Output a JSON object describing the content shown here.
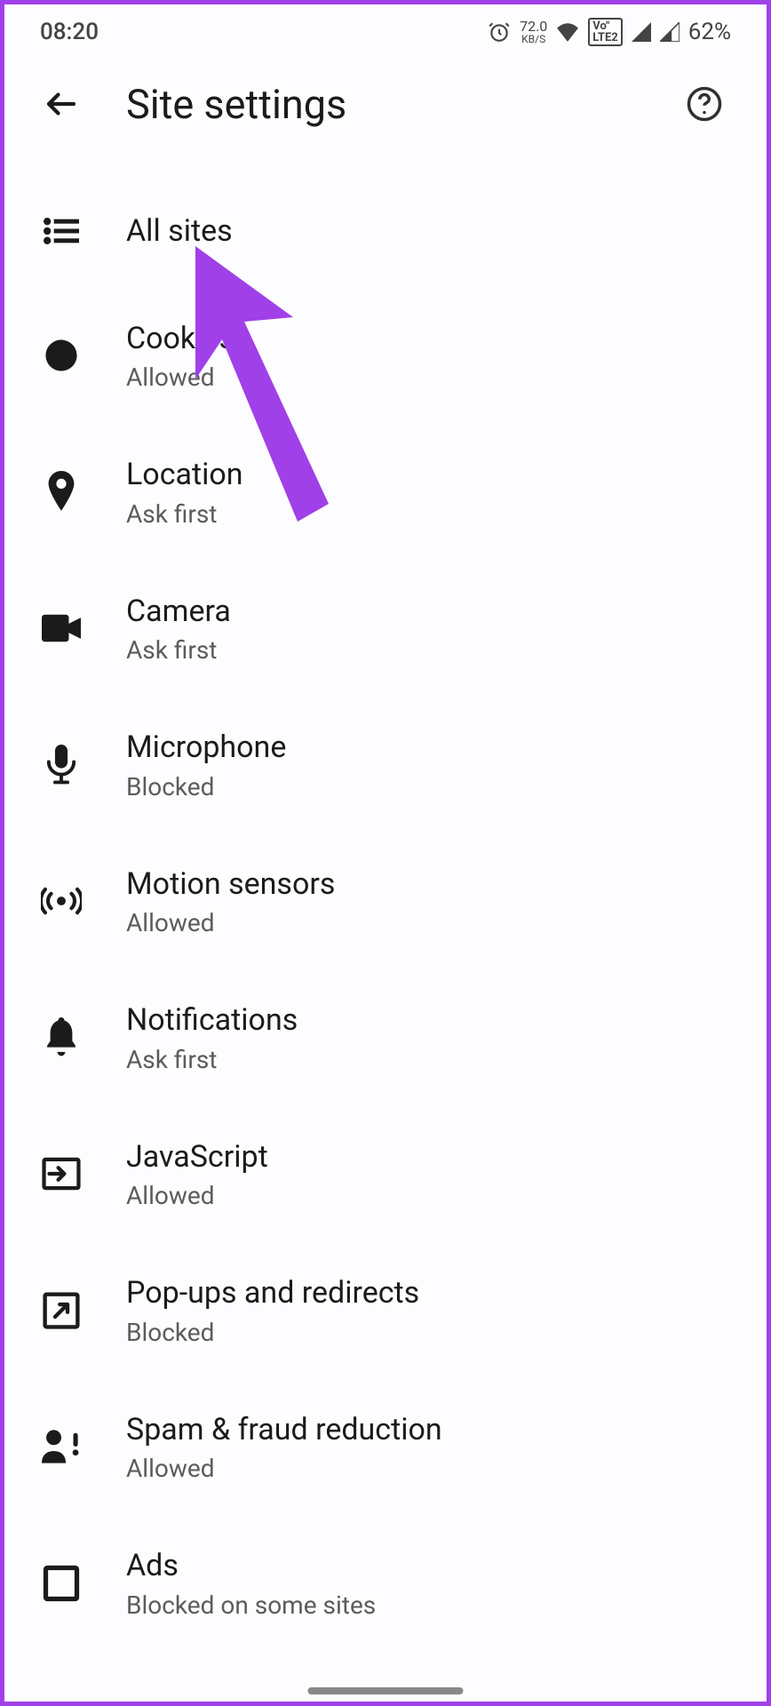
{
  "status": {
    "time": "08:20",
    "speed_top": "72.0",
    "speed_bot": "KB/S",
    "volte_top": "Vo\"",
    "volte_bot": "LTE2",
    "battery_pct": "62%"
  },
  "header": {
    "title": "Site settings"
  },
  "items": [
    {
      "title": "All sites",
      "sub": null
    },
    {
      "title": "Cookies",
      "sub": "Allowed"
    },
    {
      "title": "Location",
      "sub": "Ask first"
    },
    {
      "title": "Camera",
      "sub": "Ask first"
    },
    {
      "title": "Microphone",
      "sub": "Blocked"
    },
    {
      "title": "Motion sensors",
      "sub": "Allowed"
    },
    {
      "title": "Notifications",
      "sub": "Ask first"
    },
    {
      "title": "JavaScript",
      "sub": "Allowed"
    },
    {
      "title": "Pop-ups and redirects",
      "sub": "Blocked"
    },
    {
      "title": "Spam & fraud reduction",
      "sub": "Allowed"
    },
    {
      "title": "Ads",
      "sub": "Blocked on some sites"
    }
  ]
}
